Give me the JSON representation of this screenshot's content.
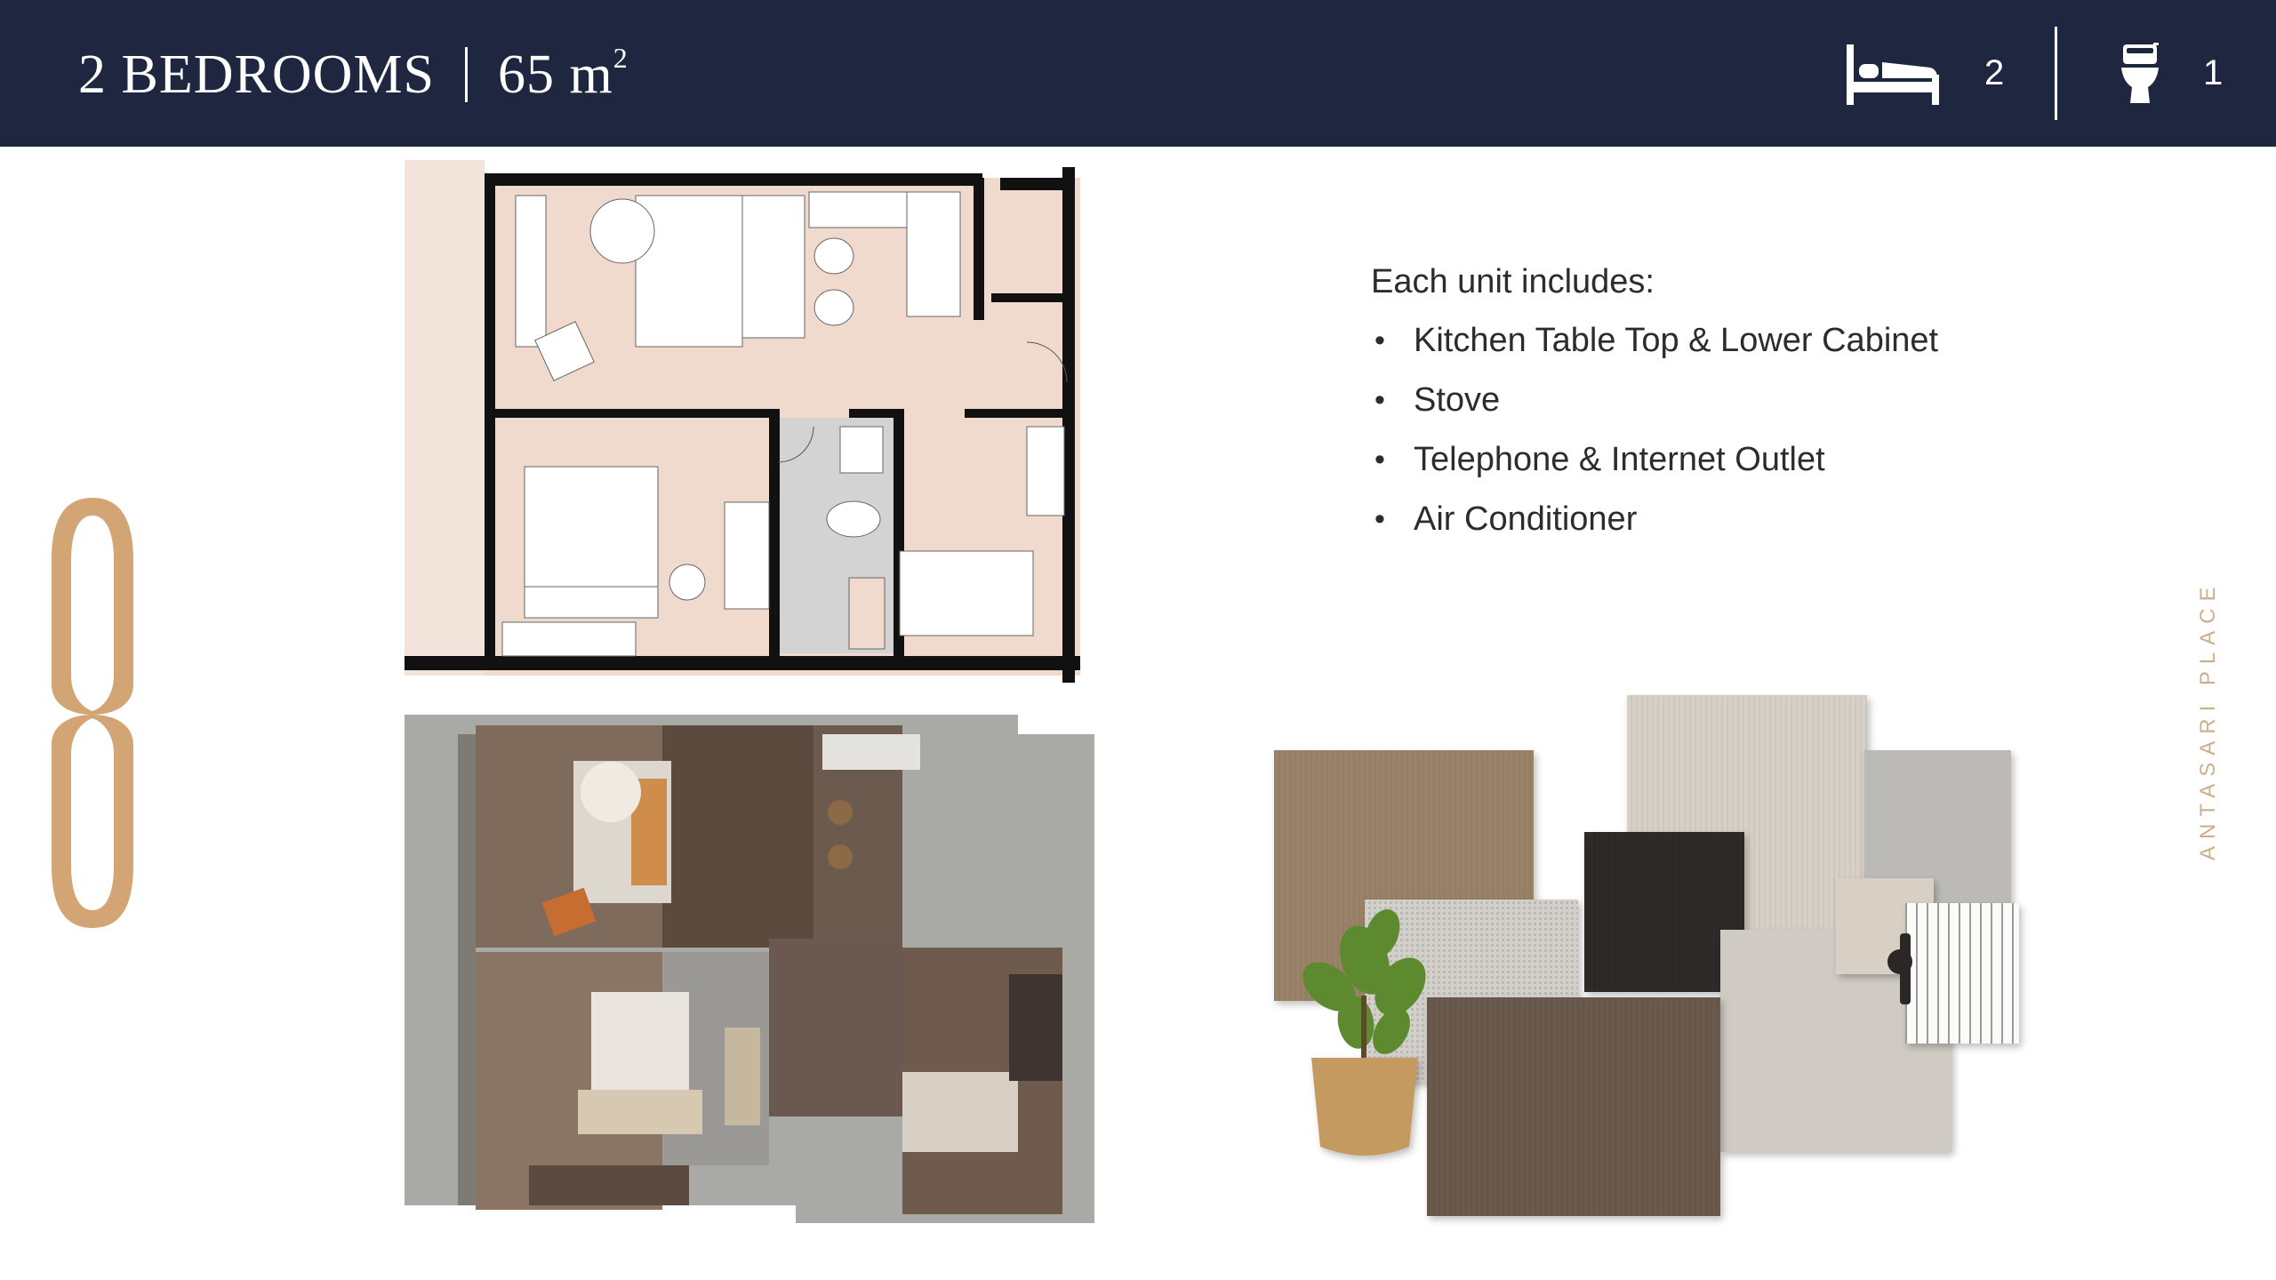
{
  "header": {
    "bedrooms_label": "2 BEDROOMS",
    "area_value": "65 m",
    "area_unit_sup": "2",
    "bedroom_count": "2",
    "bathroom_count": "1",
    "bed_icon": "bed-icon",
    "toilet_icon": "toilet-icon",
    "background_color": "#1f2740"
  },
  "features": {
    "intro": "Each unit includes:",
    "items": [
      "Kitchen Table Top & Lower Cabinet",
      "Stove",
      "Telephone & Internet Outlet",
      "Air Conditioner"
    ]
  },
  "brand": {
    "vertical_text": "ANTASARI PLACE",
    "accent_color": "#d4a574"
  }
}
